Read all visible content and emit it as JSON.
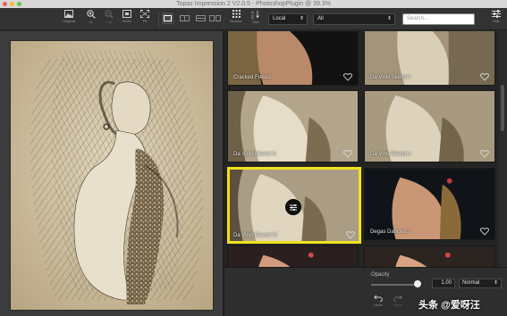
{
  "window": {
    "title": "Topaz Impression 2 V2.0.5 - PhotoshopPlugin @ 39.3%"
  },
  "toolbar": {
    "original_label": "Original",
    "zoom_in_label": "In",
    "zoom_out_label": "Out",
    "zoom_100_label": "100%",
    "fit_label": "Fit"
  },
  "browser": {
    "browse_label": "Browse",
    "sort_label": "Sort",
    "source_selected": "Local",
    "category_selected": "All",
    "search_placeholder": "Search...",
    "edit_label": "Edit"
  },
  "presets": [
    {
      "name": "Cracked Fresco"
    },
    {
      "name": "Da Vinci Sketch I"
    },
    {
      "name": "Da Vinci Sketch II"
    },
    {
      "name": "Da Vinci Sketch I"
    },
    {
      "name": "Da Vinci Sketch III",
      "selected": true
    },
    {
      "name": "Degas Dancers I"
    },
    {
      "name": ""
    },
    {
      "name": ""
    }
  ],
  "adjust": {
    "opacity_label": "Opacity",
    "opacity_value": "1.00",
    "opacity_fraction": 1.0,
    "blend_mode": "Normal",
    "undo_label": "Undo",
    "redo_label": "Redo"
  },
  "watermark": {
    "text": "头条 @爱呀汪"
  },
  "colors": {
    "selection": "#f2e21a",
    "panel": "#242424",
    "sketch_paper": "#d4c5a7"
  }
}
